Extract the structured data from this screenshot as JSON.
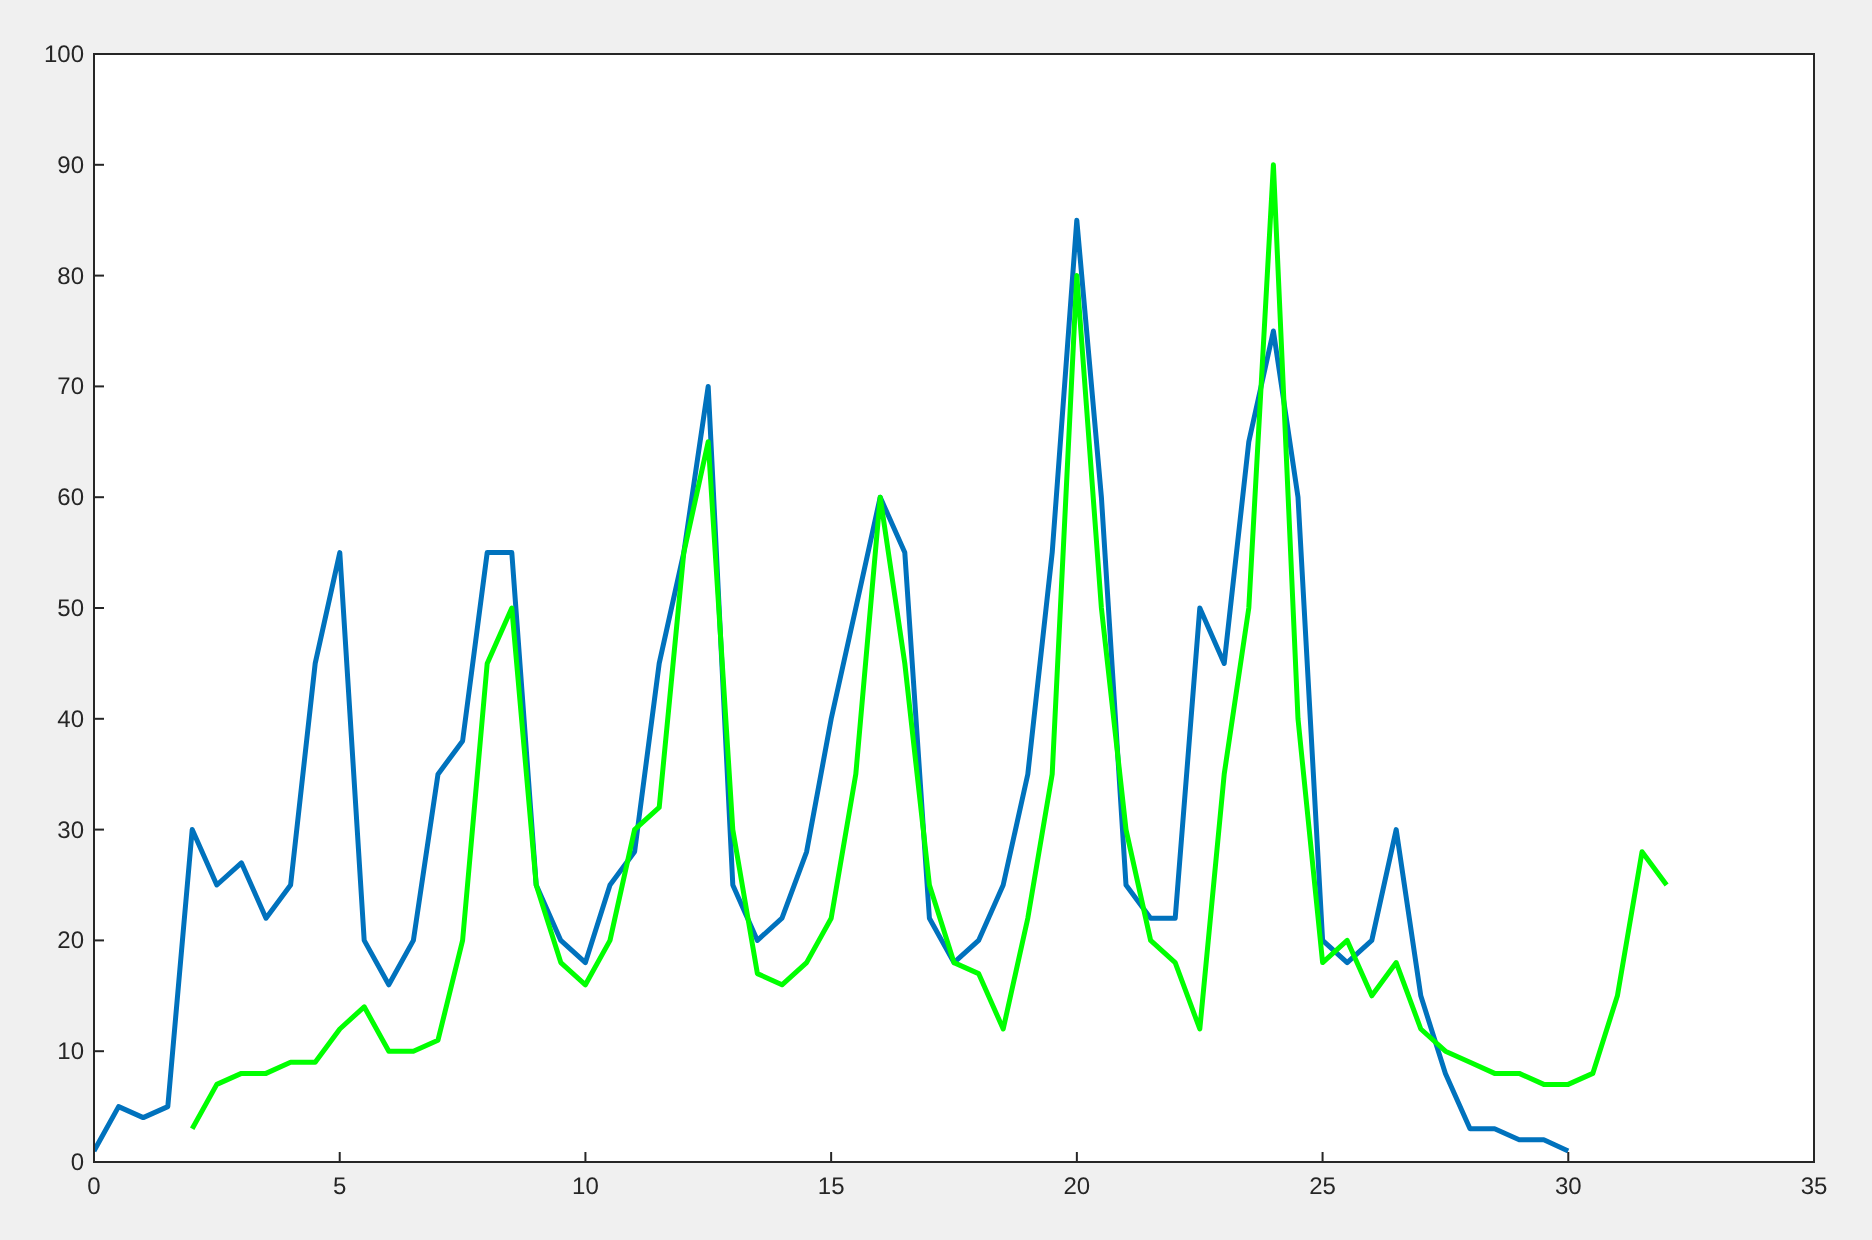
{
  "figure": {
    "chart_data": {
      "type": "line",
      "x": [
        0,
        0.5,
        1,
        1.5,
        2,
        2.5,
        3,
        3.5,
        4,
        4.5,
        5,
        5.5,
        6,
        6.5,
        7,
        7.5,
        8,
        8.5,
        9,
        9.5,
        10,
        10.5,
        11,
        11.5,
        12,
        12.5,
        13,
        13.5,
        14,
        14.5,
        15,
        15.5,
        16,
        16.5,
        17,
        17.5,
        18,
        18.5,
        19,
        19.5,
        20,
        20.5,
        21,
        21.5,
        22,
        22.5,
        23,
        23.5,
        24,
        24.5,
        25,
        25.5,
        26,
        26.5,
        27,
        27.5,
        28,
        28.5,
        29,
        29.5,
        30,
        30.5,
        31,
        31.5,
        32
      ],
      "series": [
        {
          "color": "#0072bd",
          "values": [
            1,
            5,
            4,
            5,
            30,
            25,
            27,
            22,
            25,
            45,
            55,
            20,
            16,
            20,
            35,
            38,
            55,
            55,
            25,
            20,
            18,
            25,
            28,
            45,
            55,
            70,
            25,
            20,
            22,
            28,
            40,
            50,
            60,
            55,
            22,
            18,
            20,
            25,
            35,
            55,
            85,
            60,
            25,
            22,
            22,
            50,
            45,
            65,
            75,
            60,
            20,
            18,
            20,
            30,
            15,
            8,
            3,
            3,
            2,
            2,
            1,
            null,
            null,
            null,
            null
          ]
        },
        {
          "color": "#00ff00",
          "values": [
            null,
            null,
            null,
            null,
            3,
            7,
            8,
            8,
            9,
            9,
            12,
            14,
            10,
            10,
            11,
            20,
            45,
            50,
            25,
            18,
            16,
            20,
            30,
            32,
            55,
            65,
            30,
            17,
            16,
            18,
            22,
            35,
            60,
            45,
            25,
            18,
            17,
            12,
            22,
            35,
            80,
            50,
            30,
            20,
            18,
            12,
            35,
            50,
            90,
            40,
            18,
            20,
            15,
            18,
            12,
            10,
            9,
            8,
            8,
            7,
            7,
            8,
            15,
            28,
            25
          ]
        }
      ],
      "xlim": [
        0,
        35
      ],
      "ylim": [
        0,
        100
      ],
      "xticks": [
        0,
        5,
        10,
        15,
        20,
        25,
        30,
        35
      ],
      "yticks": [
        0,
        10,
        20,
        30,
        40,
        50,
        60,
        70,
        80,
        90,
        100
      ]
    }
  }
}
